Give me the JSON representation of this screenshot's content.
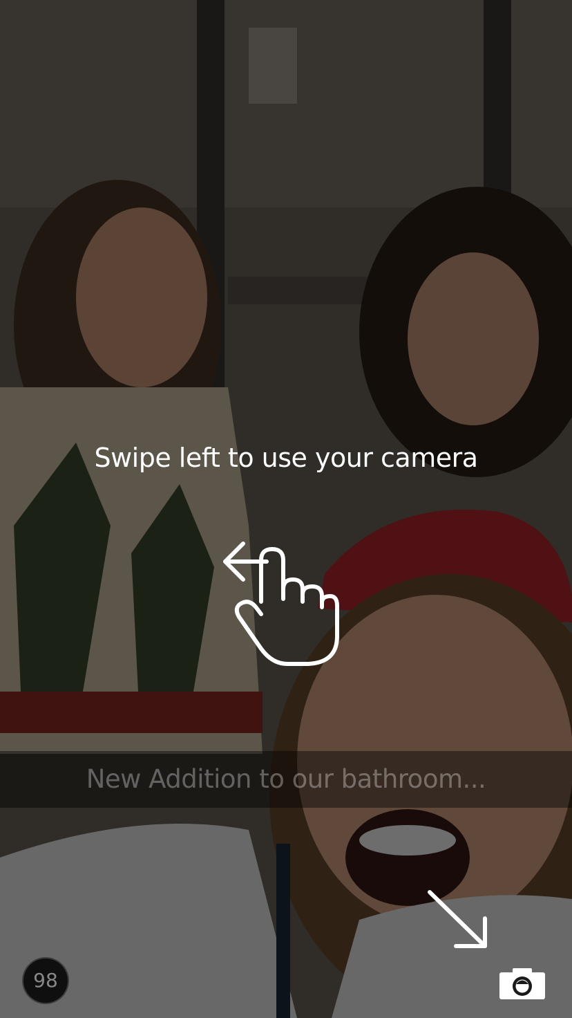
{
  "tutorial": {
    "hint_text": "Swipe left to use your camera",
    "gesture_icon": "swipe-left-hand-icon",
    "arrow_icon": "diagonal-arrow-icon"
  },
  "snap": {
    "caption": "New Addition to our bathroom...",
    "timer_seconds": "98"
  },
  "controls": {
    "camera_icon": "camera-icon"
  },
  "colors": {
    "overlay": "#000000",
    "text": "#ffffff"
  }
}
